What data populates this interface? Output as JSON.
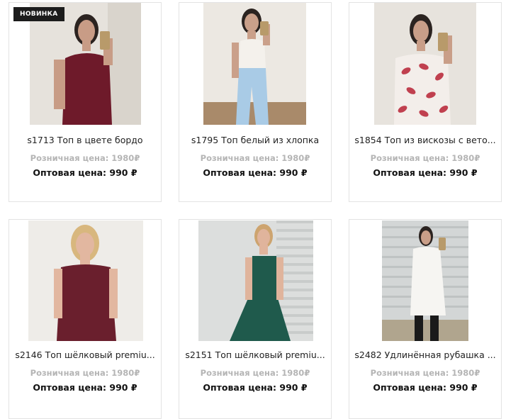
{
  "badge_new": "НОВИНКА",
  "products": [
    {
      "title": "s1713 Топ в цвете бордо",
      "retail": "Розничная цена: 1980₽",
      "wholesale": "Оптовая цена: 990 ₽",
      "image": "model-burgundy-top-mirror-selfie"
    },
    {
      "title": "s1795 Топ белый из хлопка",
      "retail": "Розничная цена: 1980₽",
      "wholesale": "Оптовая цена: 990 ₽",
      "image": "model-white-top-blue-trousers-selfie"
    },
    {
      "title": "s1854 Топ из вискозы с вето...",
      "retail": "Розничная цена: 1980₽",
      "wholesale": "Оптовая цена: 990 ₽",
      "image": "model-leaf-print-top-selfie"
    },
    {
      "title": "s2146 Топ шёлковый premiu...",
      "retail": "Розничная цена: 1980₽",
      "wholesale": "Оптовая цена: 990 ₽",
      "image": "blonde-model-burgundy-silk-set"
    },
    {
      "title": "s2151 Топ шёлковый premiu...",
      "retail": "Розничная цена: 1980₽",
      "wholesale": "Оптовая цена: 990 ₽",
      "image": "model-green-silk-slip-set"
    },
    {
      "title": "s2482 Удлинённая рубашка ...",
      "retail": "Розничная цена: 1980₽",
      "wholesale": "Оптовая цена: 990 ₽",
      "image": "model-long-white-shirt-selfie"
    }
  ]
}
